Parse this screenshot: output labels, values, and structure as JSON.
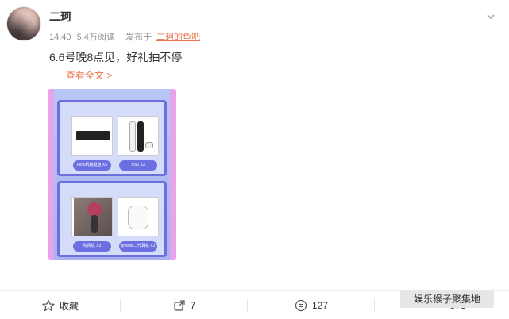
{
  "user": {
    "name": "二珂",
    "time": "14:40",
    "views": "5.4万阅读",
    "source_prefix": "发布于",
    "source_name": "二珂的鱼吧"
  },
  "post": {
    "text": "6.6号晚8点见，好礼抽不停",
    "read_more": "查看全文 >"
  },
  "poster": {
    "prizes": [
      {
        "label": "Filco机械键盘",
        "qty": "X5"
      },
      {
        "label": "PS5",
        "qty": "X2"
      },
      {
        "label": "吹风机",
        "qty": "X3"
      },
      {
        "label": "Iphone二代耳机",
        "qty": "X3"
      }
    ]
  },
  "actions": {
    "favorite_label": "收藏",
    "share_count": "7",
    "comment_count": "127",
    "like_count": "373"
  },
  "watermark": "娱乐猴子聚集地",
  "colors": {
    "accent": "#eb7350",
    "poster_frame": "#6b6fe0",
    "poster_bg": "#b8c6f5"
  }
}
